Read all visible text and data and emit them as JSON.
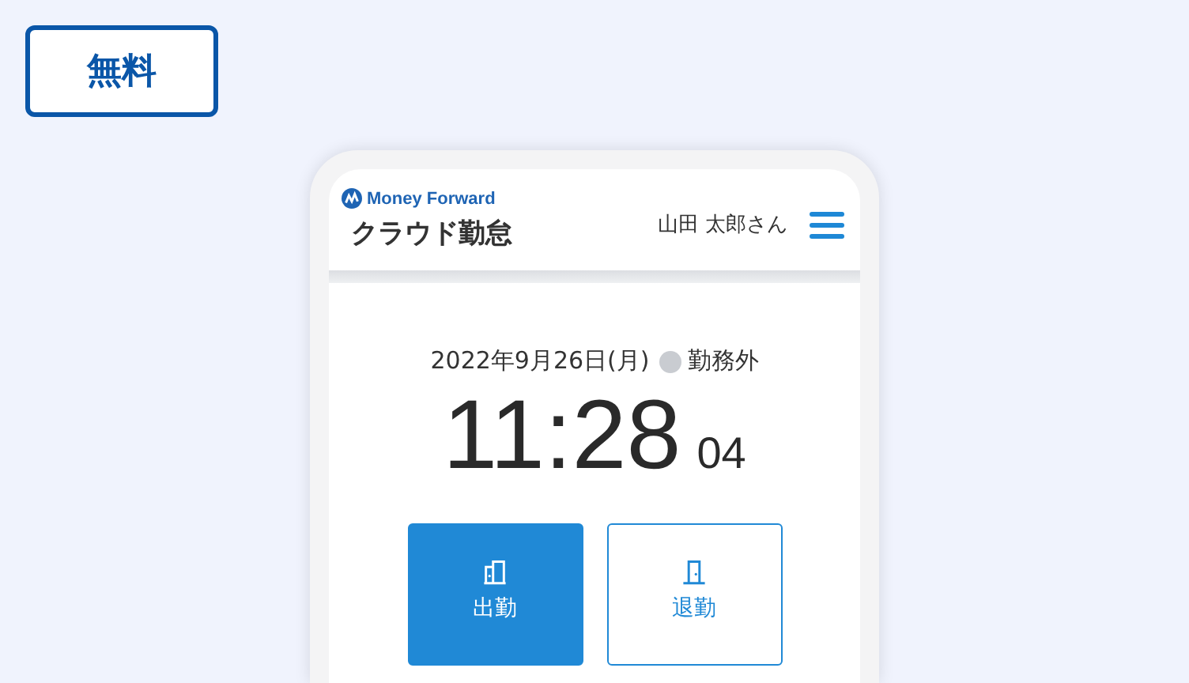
{
  "badge": {
    "label": "無料"
  },
  "app_header": {
    "brand": "Money Forward",
    "product": "クラウド勤怠",
    "user": "山田 太郎さん"
  },
  "clock": {
    "date": "2022年9月26日(月)",
    "status": "勤務外",
    "time": "11:28",
    "seconds": "04"
  },
  "buttons": [
    {
      "label": "出勤",
      "kind": "filled"
    },
    {
      "label": "退勤",
      "kind": "outlined"
    }
  ]
}
